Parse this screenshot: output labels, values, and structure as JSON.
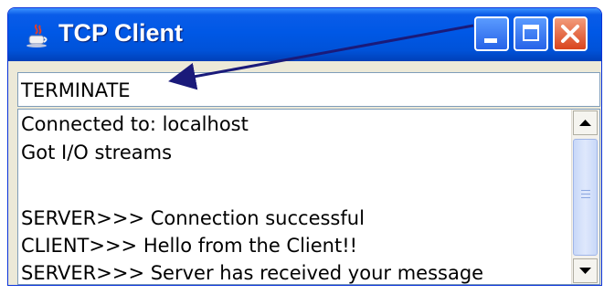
{
  "window": {
    "title": "TCP Client",
    "app_icon": "java-cup-icon",
    "buttons": {
      "minimize": "minimize-icon",
      "maximize": "maximize-icon",
      "close": "close-icon"
    },
    "colors": {
      "titlebar": "#0058e6",
      "close_button": "#d9441e",
      "frame": "#ece9d8"
    }
  },
  "input": {
    "value": "TERMINATE"
  },
  "output": {
    "lines": [
      "Connected to: localhost",
      "Got I/O streams",
      "",
      "SERVER>>> Connection successful",
      "CLIENT>>> Hello from the Client!!",
      "SERVER>>> Server has received your message"
    ]
  },
  "annotation": {
    "arrow_color": "#1a1a7a"
  }
}
